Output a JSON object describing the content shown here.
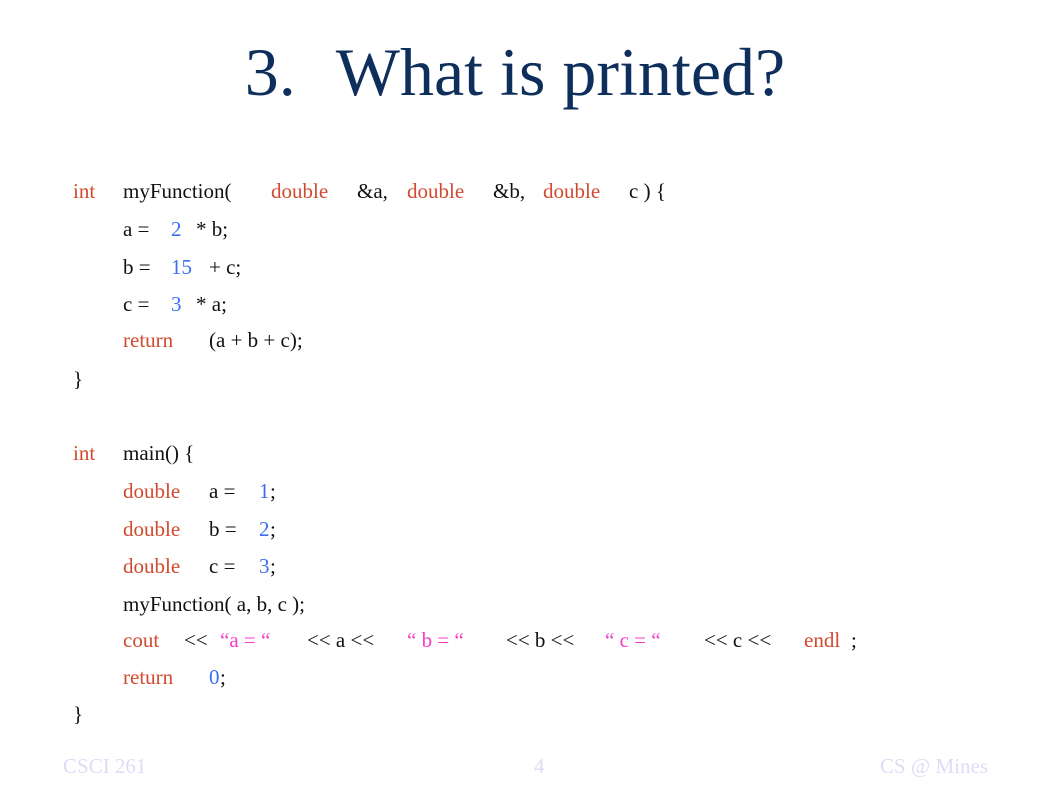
{
  "slide": {
    "title_number": "3.",
    "title_text": "What is printed?",
    "function_block": {
      "signature": {
        "return_type": "int",
        "name": "myFunction(",
        "param1_type": "double",
        "param1_name": "&a,",
        "param2_type": "double",
        "param2_name": "&b,",
        "param3_type": "double",
        "param3_name": "c ) {"
      },
      "line_a": {
        "lhs": "a =",
        "num": "2",
        "rhs": "* b;"
      },
      "line_b": {
        "lhs": "b =",
        "num": "15",
        "rhs": "+ c;"
      },
      "line_c": {
        "lhs": "c =",
        "num": "3",
        "rhs": "* a;"
      },
      "return_line": {
        "kw": "return",
        "expr": "(a + b + c);"
      },
      "close": "}"
    },
    "main_block": {
      "signature": {
        "return_type": "int",
        "name": "main() {"
      },
      "decl_a": {
        "type": "double",
        "lhs": "a =",
        "num": "1",
        "end": ";"
      },
      "decl_b": {
        "type": "double",
        "lhs": "b =",
        "num": "2",
        "end": ";"
      },
      "decl_c": {
        "type": "double",
        "lhs": "c =",
        "num": "3",
        "end": ";"
      },
      "call": "myFunction( a, b, c );",
      "cout_line": {
        "cout": "cout",
        "op1": "<<",
        "str_a": "“a = “",
        "part_a": "<< a <<",
        "str_b": "“ b = “",
        "part_b": "<< b <<",
        "str_c": "“ c = “",
        "part_c": "<< c <<",
        "endl": "endl",
        "end": ";"
      },
      "return_line": {
        "kw": "return",
        "num": "0",
        "end": ";"
      },
      "close": "}"
    },
    "footer": {
      "course": "CSCI 261",
      "page": "4",
      "org": "CS @ Mines"
    },
    "colors": {
      "title": "#0e2f5c",
      "keyword": "#d14a2f",
      "number": "#3b6ef2",
      "string": "#f53bc8",
      "footer": "#dcdcf7"
    }
  }
}
